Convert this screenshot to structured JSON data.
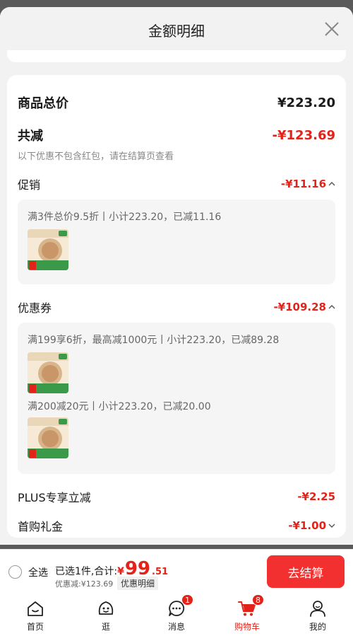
{
  "sheet": {
    "title": "金额明细"
  },
  "summary": {
    "goods_total_label": "商品总价",
    "goods_total_value": "¥223.20",
    "total_reduction_label": "共减",
    "total_reduction_value": "-¥123.69",
    "note": "以下优惠不包含红包，请在结算页查看"
  },
  "promotion": {
    "label": "促销",
    "value": "-¥11.16",
    "lines": [
      "满3件总价9.5折丨小计223.20，已减11.16"
    ]
  },
  "coupon": {
    "label": "优惠券",
    "value": "-¥109.28",
    "lines": [
      "满199享6折，最高减1000元丨小计223.20，已减89.28",
      "满200减20元丨小计223.20，已减20.00"
    ]
  },
  "plus": {
    "label": "PLUS专享立减",
    "value": "-¥2.25"
  },
  "first_purchase": {
    "label": "首购礼金",
    "value": "-¥1.00"
  },
  "bottom": {
    "select_all": "全选",
    "selected_text": "已选1件,合计:",
    "currency": "¥",
    "total_int": "99",
    "total_dec": ".51",
    "discount_text": "优惠减:¥123.69",
    "detail_chip": "优惠明细",
    "checkout": "去结算"
  },
  "tabs": [
    {
      "label": "首页",
      "icon": "home-icon"
    },
    {
      "label": "逛",
      "icon": "browse-icon"
    },
    {
      "label": "消息",
      "icon": "message-icon",
      "badge": "1"
    },
    {
      "label": "购物车",
      "icon": "cart-icon",
      "badge": "8",
      "active": true
    },
    {
      "label": "我的",
      "icon": "profile-icon"
    }
  ],
  "colors": {
    "accent_red": "#e2231a",
    "checkout_button": "#f23030"
  }
}
